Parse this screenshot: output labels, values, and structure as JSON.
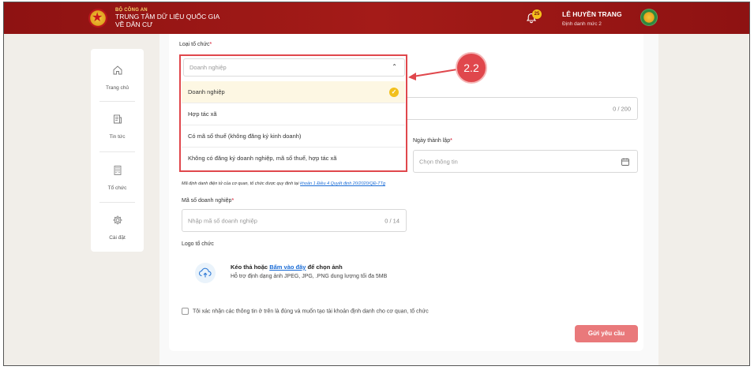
{
  "header": {
    "org_small": "BỘ CÔNG AN",
    "org_line1": "TRUNG TÂM DỮ LIỆU QUỐC GIA",
    "org_line2": "VỀ DÂN CƯ",
    "notification_count": "25",
    "user_name": "LÊ HUYỀN TRANG",
    "user_level": "Định danh mức 2"
  },
  "sidebar": {
    "items": [
      {
        "label": "Trang chủ",
        "icon": "home-icon"
      },
      {
        "label": "Tin tức",
        "icon": "news-icon"
      },
      {
        "label": "Tổ chức",
        "icon": "building-icon"
      },
      {
        "label": "Cài đặt",
        "icon": "gear-icon"
      }
    ]
  },
  "form": {
    "org_type_label": "Loại tổ chức",
    "org_type_placeholder": "Doanh nghiệp",
    "options": [
      {
        "label": "Doanh nghiệp",
        "selected": true
      },
      {
        "label": "Hợp tác xã",
        "selected": false
      },
      {
        "label": "Có mã số thuế (không đăng ký kinh doanh)",
        "selected": false
      },
      {
        "label": "Không có đăng ký doanh nghiệp, mã số thuế, hợp tác xã",
        "selected": false
      }
    ],
    "name_counter": "0 / 200",
    "founding_date_label": "Ngày thành lập",
    "founding_date_placeholder": "Chọn thông tin",
    "note_text": "Mã định danh điện tử của cơ quan, tổ chức được quy định tại ",
    "note_link": "khoản 1 Điều 4 Quyết định 20/2020/QĐ-TTg",
    "biz_code_label": "Mã số doanh nghiệp",
    "biz_code_placeholder": "Nhập mã số doanh nghiệp",
    "biz_code_counter": "0 / 14",
    "logo_label": "Logo tổ chức",
    "upload_prefix": "Kéo thả hoặc ",
    "upload_link": "Bấm vào đây",
    "upload_suffix": " để chọn ảnh",
    "upload_hint": "Hỗ trợ định dạng ảnh JPEG, JPG, .PNG dung lượng tối đa 5MB",
    "confirm_text": "Tôi xác nhận các thông tin ở trên là đúng và muốn tạo tài khoản định danh cho cơ quan, tổ chức",
    "submit_label": "Gửi yêu cầu"
  },
  "annotation": {
    "step_label": "2.2",
    "color": "#e0474c"
  }
}
